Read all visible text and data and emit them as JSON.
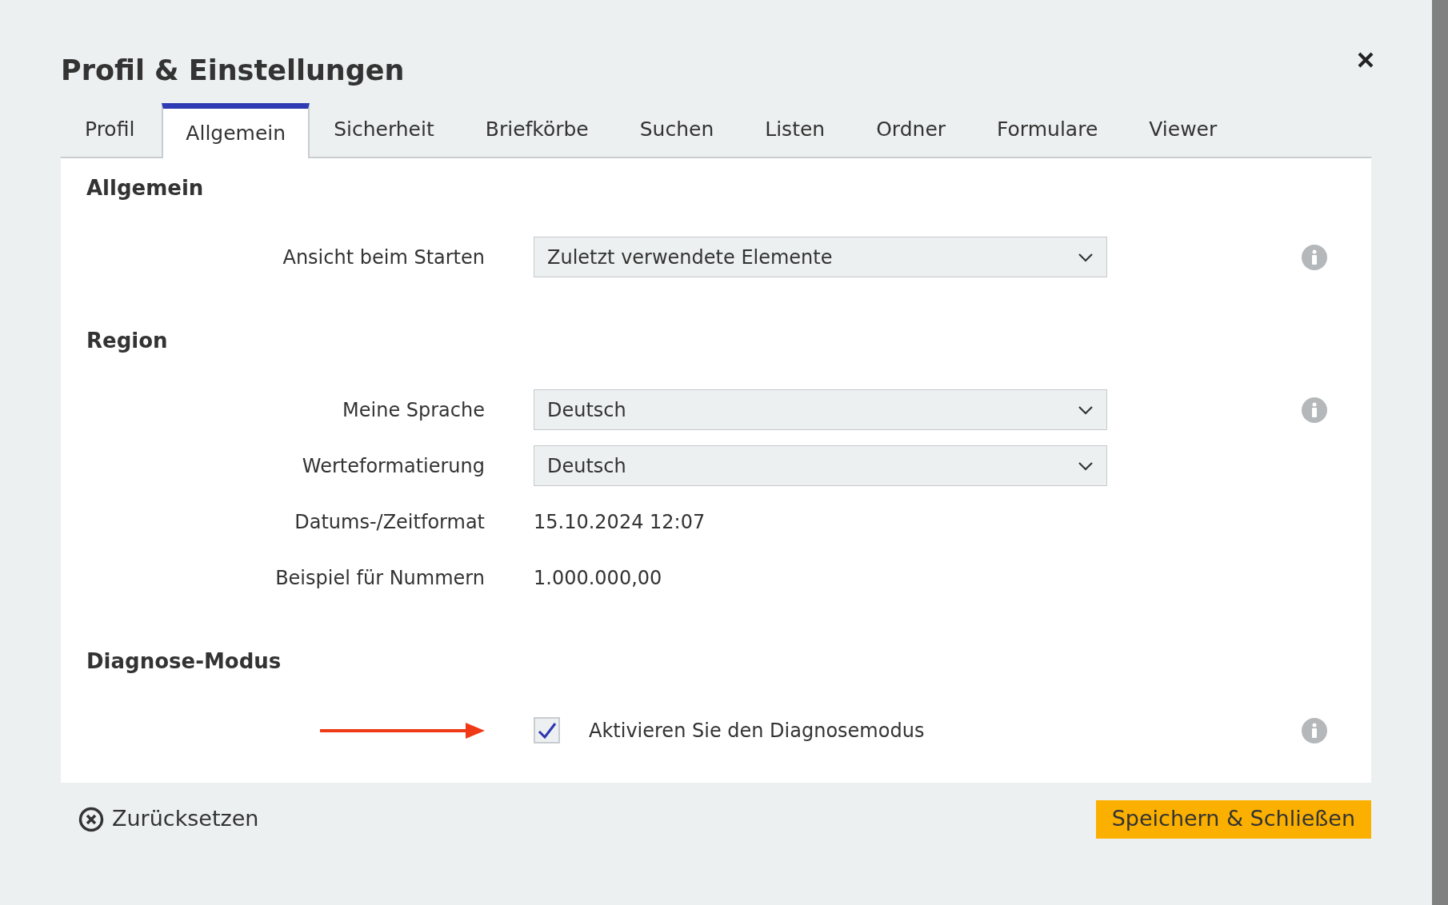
{
  "dialog": {
    "title": "Profil & Einstellungen"
  },
  "tabs": [
    {
      "label": "Profil",
      "selected": false
    },
    {
      "label": "Allgemein",
      "selected": true
    },
    {
      "label": "Sicherheit",
      "selected": false
    },
    {
      "label": "Briefkörbe",
      "selected": false
    },
    {
      "label": "Suchen",
      "selected": false
    },
    {
      "label": "Listen",
      "selected": false
    },
    {
      "label": "Ordner",
      "selected": false
    },
    {
      "label": "Formulare",
      "selected": false
    },
    {
      "label": "Viewer",
      "selected": false
    }
  ],
  "sections": [
    {
      "heading": "Allgemein",
      "rows": [
        {
          "kind": "select",
          "label": "Ansicht beim Starten",
          "value": "Zuletzt verwendete Elemente",
          "info": true
        }
      ]
    },
    {
      "heading": "Region",
      "rows": [
        {
          "kind": "select",
          "label": "Meine Sprache",
          "value": "Deutsch",
          "info": true
        },
        {
          "kind": "select",
          "label": "Werteformatierung",
          "value": "Deutsch",
          "info": false
        },
        {
          "kind": "text",
          "label": "Datums-/Zeitformat",
          "value": "15.10.2024 12:07",
          "info": false
        },
        {
          "kind": "text",
          "label": "Beispiel für Nummern",
          "value": "1.000.000,00",
          "info": false
        }
      ]
    },
    {
      "heading": "Diagnose-Modus",
      "rows": [
        {
          "kind": "checkbox",
          "label": "Aktivieren Sie den Diagnosemodus",
          "checked": true,
          "info": true
        }
      ]
    }
  ],
  "footer": {
    "reset": "Zurücksetzen",
    "save": "Speichern & Schließen"
  }
}
